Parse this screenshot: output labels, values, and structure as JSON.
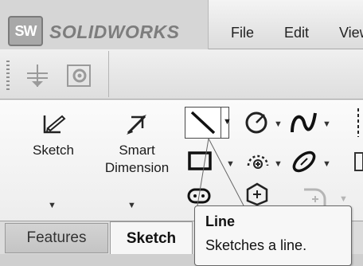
{
  "titlebar": {
    "logo_text": "SW",
    "brand": "SOLIDWORKS",
    "menu": [
      {
        "label": "File"
      },
      {
        "label": "Edit"
      },
      {
        "label": "View"
      }
    ]
  },
  "quick_toolbar": {
    "icons": [
      "snap-grid-icon",
      "options-gear-icon"
    ]
  },
  "ribbon": {
    "sketch_label": "Sketch",
    "smart_dimension_line1": "Smart",
    "smart_dimension_line2": "Dimension",
    "small_tools": [
      "line-icon",
      "circle-icon",
      "spline-icon",
      "rectangle-icon",
      "arc-icon",
      "ellipse-icon",
      "slot-icon",
      "polygon-icon",
      "fillet-icon"
    ]
  },
  "tabs": [
    {
      "label": "Features"
    },
    {
      "label": "Sketch"
    }
  ],
  "tooltip": {
    "title": "Line",
    "description": "Sketches a line."
  }
}
